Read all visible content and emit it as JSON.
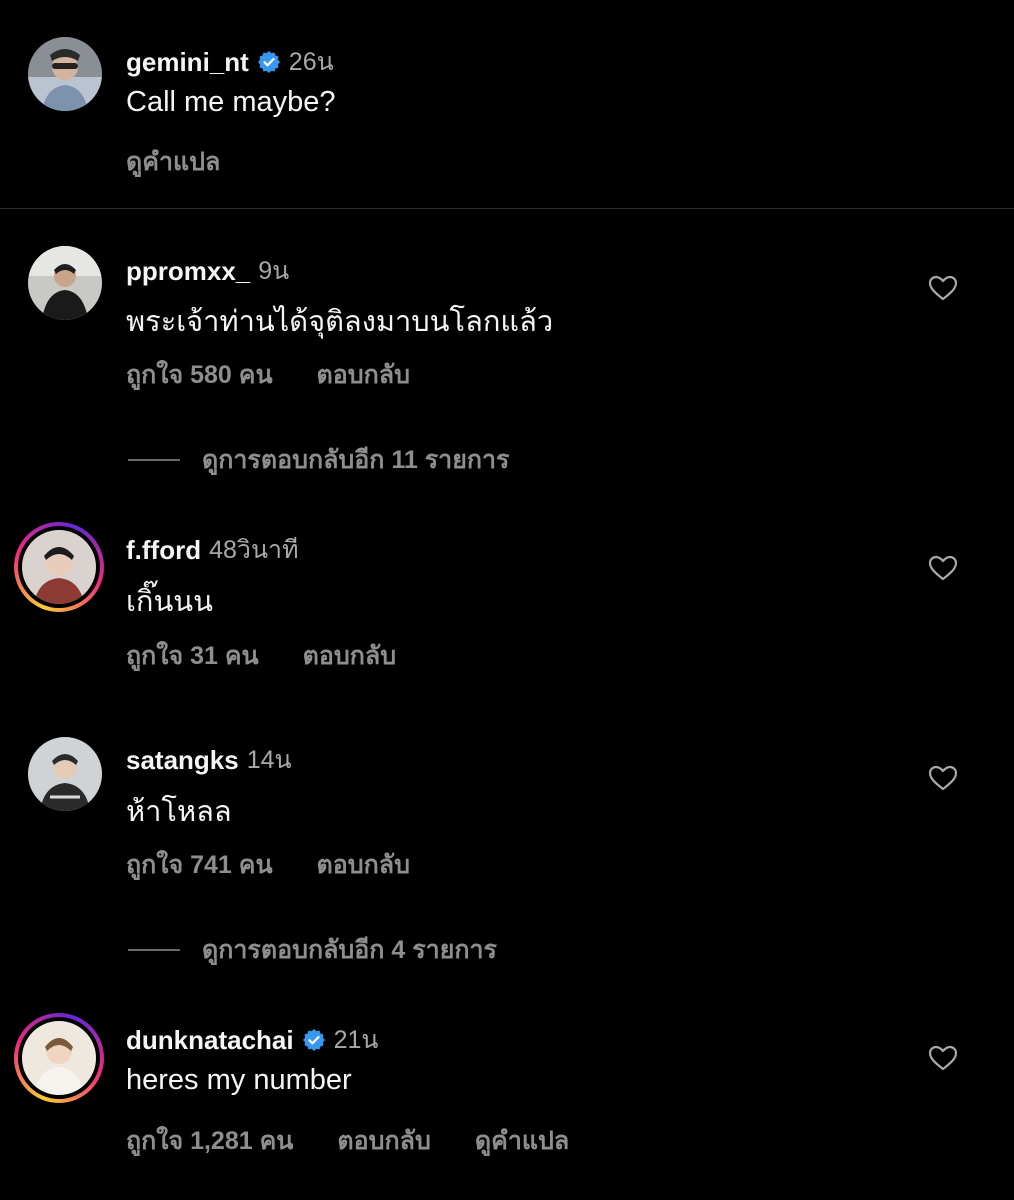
{
  "caption": {
    "username": "gemini_nt",
    "verified": true,
    "time": "26น",
    "text": "Call me maybe?",
    "see_translation": "ดูคำแปล"
  },
  "comments": [
    {
      "username": "ppromxx_",
      "verified": false,
      "story_ring": false,
      "time": "9น",
      "text": "พระเจ้าท่านได้จุติลงมาบนโลกแล้ว",
      "likes": "ถูกใจ 580 คน",
      "reply": "ตอบกลับ",
      "view_replies": "ดูการตอบกลับอีก 11 รายการ"
    },
    {
      "username": "f.fford",
      "verified": false,
      "story_ring": true,
      "time": "48วินาที",
      "text": "เกิ๊นนน",
      "likes": "ถูกใจ 31 คน",
      "reply": "ตอบกลับ"
    },
    {
      "username": "satangks",
      "verified": false,
      "story_ring": false,
      "time": "14น",
      "text": "ห้าโหลล",
      "likes": "ถูกใจ 741 คน",
      "reply": "ตอบกลับ",
      "view_replies": "ดูการตอบกลับอีก 4 รายการ"
    },
    {
      "username": "dunknatachai",
      "verified": true,
      "story_ring": true,
      "time": "21น",
      "text": "heres my number",
      "likes": "ถูกใจ 1,281 คน",
      "reply": "ตอบกลับ",
      "see_translation": "ดูคำแปล"
    }
  ],
  "colors": {
    "background": "#000000",
    "primary_text": "#f5f5f5",
    "secondary_text": "#8e8e8e",
    "verified_blue": "#3897f0"
  },
  "icons": {
    "verified": "verified-badge-icon",
    "like": "heart-outline-icon"
  }
}
